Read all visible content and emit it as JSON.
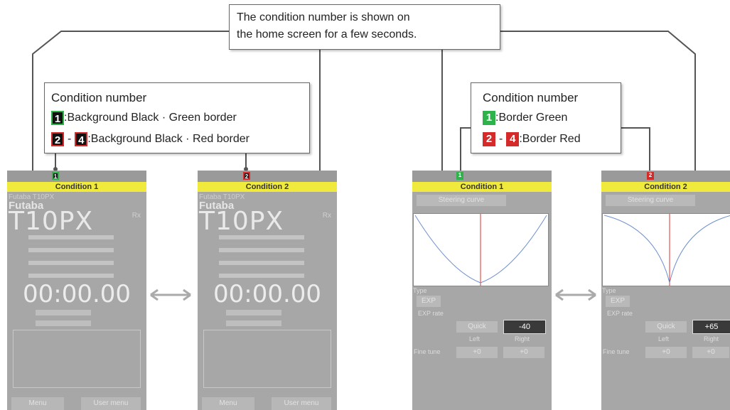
{
  "callouts": {
    "top": {
      "line1": "The condition number is shown on",
      "line2": "the home screen for a few seconds."
    },
    "left": {
      "title": "Condition number",
      "row1_num": "1",
      "row1_text": ":Background Black · Green border",
      "row2_num_a": "2",
      "row2_dash": "-",
      "row2_num_b": "4",
      "row2_text": ":Background Black · Red border"
    },
    "right": {
      "title": "Condition number",
      "row1_num": "1",
      "row1_text": ":Border Green",
      "row2_num_a": "2",
      "row2_dash": "-",
      "row2_num_b": "4",
      "row2_text": ":Border Red"
    }
  },
  "screens": {
    "home1": {
      "condition": "Condition 1",
      "badge": "1",
      "model": "Futaba T10PX",
      "brand": "Futaba",
      "logo": "T10PX",
      "rx": "Rx",
      "timer": "00:00.00",
      "menu": "Menu",
      "user_menu": "User menu"
    },
    "home2": {
      "condition": "Condition 2",
      "badge": "2",
      "model": "Futaba T10PX",
      "brand": "Futaba",
      "logo": "T10PX",
      "rx": "Rx",
      "timer": "00:00.00",
      "menu": "Menu",
      "user_menu": "User menu"
    },
    "steer1": {
      "condition": "Condition 1",
      "badge": "1",
      "title_btn": "Steering curve",
      "type_label": "Type",
      "type_value": "EXP",
      "rate_label": "EXP rate",
      "left_val": "Quick",
      "right_val": "-40",
      "left_lbl": "Left",
      "right_lbl": "Right",
      "fine_tune": "Fine tune",
      "fine_l": "+0",
      "fine_r": "+0"
    },
    "steer2": {
      "condition": "Condition 2",
      "badge": "2",
      "title_btn": "Steering curve",
      "type_label": "Type",
      "type_value": "EXP",
      "rate_label": "EXP rate",
      "left_val": "Quick",
      "right_val": "+65",
      "left_lbl": "Left",
      "right_lbl": "Right",
      "fine_tune": "Fine tune",
      "fine_l": "+0",
      "fine_r": "+0"
    }
  },
  "colors": {
    "yellow_bar": "#f0ea3c",
    "green": "#2db34a",
    "red": "#d42a2a"
  }
}
